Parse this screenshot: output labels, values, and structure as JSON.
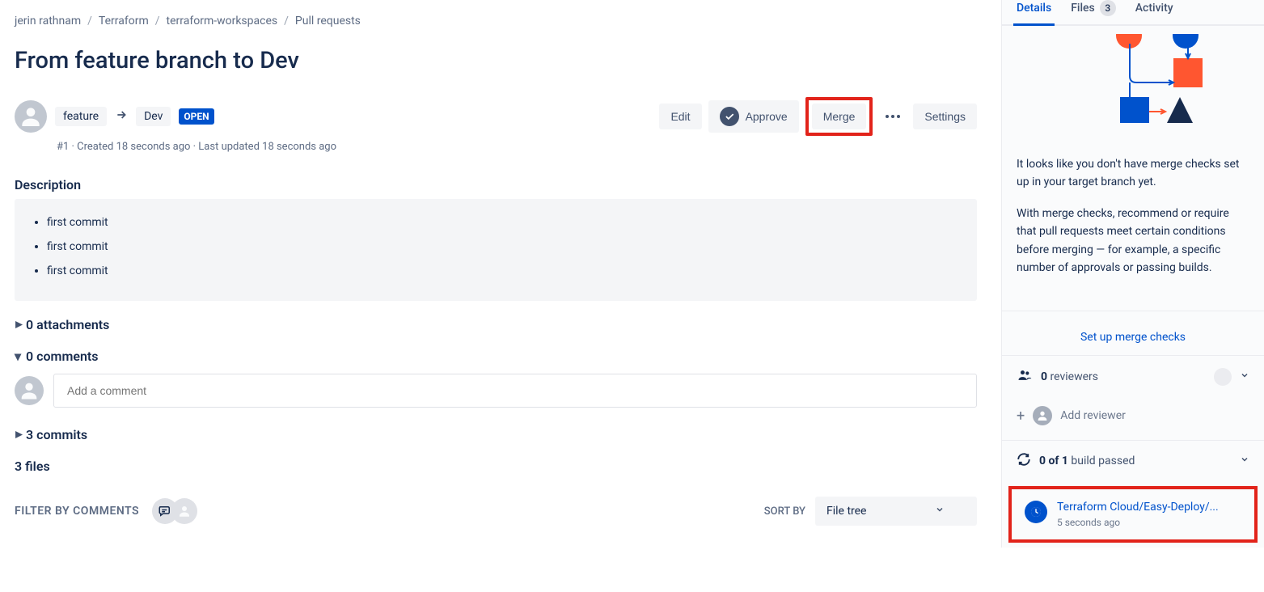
{
  "breadcrumb": {
    "owner": "jerin rathnam",
    "project": "Terraform",
    "repo": "terraform-workspaces",
    "section": "Pull requests"
  },
  "pr": {
    "title": "From feature branch to Dev",
    "source_branch": "feature",
    "target_branch": "Dev",
    "status": "OPEN",
    "meta": "#1 · Created 18 seconds ago · Last updated 18 seconds ago"
  },
  "actions": {
    "edit": "Edit",
    "approve": "Approve",
    "merge": "Merge",
    "settings": "Settings"
  },
  "description": {
    "heading": "Description",
    "items": [
      "first commit",
      "first commit",
      "first commit"
    ]
  },
  "attachments": {
    "label": "0 attachments"
  },
  "comments": {
    "label": "0 comments",
    "placeholder": "Add a comment"
  },
  "commits": {
    "label": "3 commits"
  },
  "files": {
    "label": "3 files"
  },
  "filter": {
    "label": "FILTER BY COMMENTS"
  },
  "sort": {
    "label": "SORT BY",
    "value": "File tree"
  },
  "tabs": {
    "details": "Details",
    "files": "Files",
    "files_count": "3",
    "activity": "Activity"
  },
  "merge_checks": {
    "text1": "It looks like you don't have merge checks set up in your target branch yet.",
    "text2": "With merge checks, recommend or require that pull requests meet certain conditions before merging — for example, a specific number of approvals or passing builds.",
    "link": "Set up merge checks"
  },
  "reviewers": {
    "count": "0",
    "label": "reviewers",
    "add": "Add reviewer"
  },
  "builds": {
    "status_bold": "0 of 1",
    "status_rest": "build passed",
    "item_name": "Terraform Cloud/Easy-Deploy/...",
    "item_time": "5 seconds ago"
  }
}
